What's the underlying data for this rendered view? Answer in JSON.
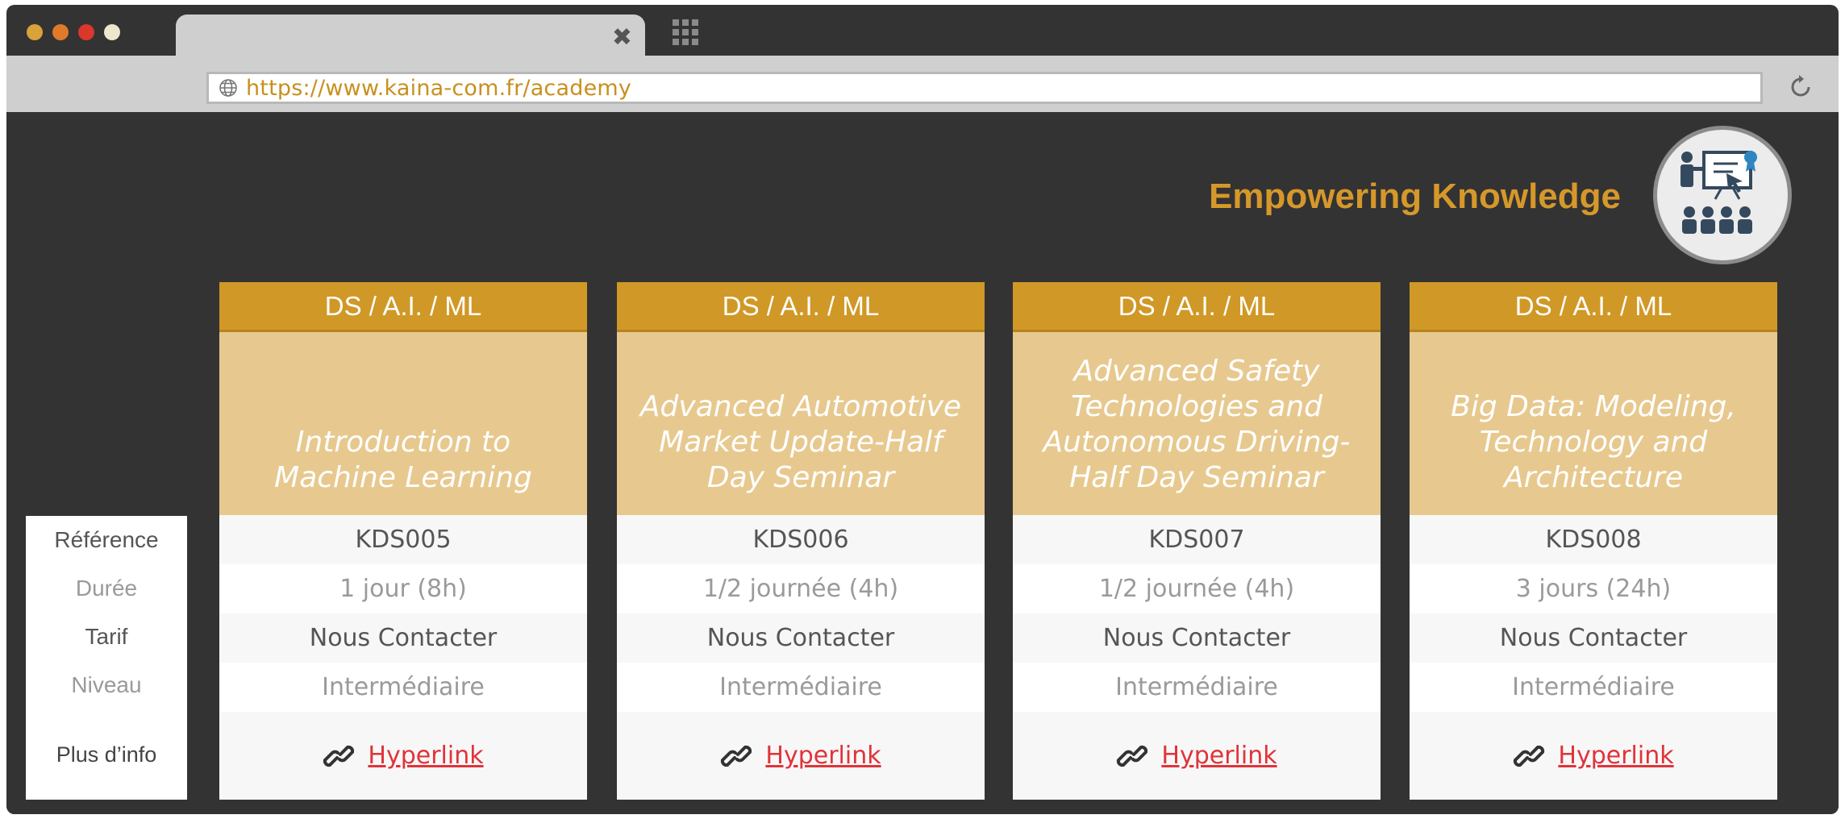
{
  "browser": {
    "dot_colors": [
      "#d9a23a",
      "#e07a2a",
      "#d9382a",
      "#efe6cc"
    ],
    "url": "https://www.kaina-com.fr/academy",
    "tab_close": "✖"
  },
  "header": {
    "tagline": "Empowering Knowledge",
    "accent": "#d6982a"
  },
  "labels": {
    "reference": "Référence",
    "duration": "Durée",
    "price": "Tarif",
    "level": "Niveau",
    "more_info": "Plus d’info"
  },
  "cards": [
    {
      "category": "DS / A.I. / ML",
      "title": "Introduction to Machine Learning",
      "reference": "KDS005",
      "duration": "1 jour (8h)",
      "price": "Nous Contacter",
      "level": "Intermédiaire",
      "link": "Hyperlink"
    },
    {
      "category": "DS / A.I. / ML",
      "title": "Advanced Automotive Market Update-Half Day Seminar",
      "reference": "KDS006",
      "duration": "1/2 journée (4h)",
      "price": "Nous Contacter",
      "level": "Intermédiaire",
      "link": "Hyperlink"
    },
    {
      "category": "DS / A.I. / ML",
      "title": "Advanced Safety Technologies and Autonomous Driving-Half Day Seminar",
      "reference": "KDS007",
      "duration": "1/2 journée (4h)",
      "price": "Nous Contacter",
      "level": "Intermédiaire",
      "link": "Hyperlink"
    },
    {
      "category": "DS / A.I. / ML",
      "title": "Big Data: Modeling, Technology and Architecture",
      "reference": "KDS008",
      "duration": "3 jours (24h)",
      "price": "Nous Contacter",
      "level": "Intermédiaire",
      "link": "Hyperlink"
    }
  ],
  "icons": {
    "globe": "globe-icon",
    "reload": "reload-icon",
    "apps": "apps-grid-icon",
    "logo": "presenter-audience-icon",
    "link": "chain-link-icon"
  }
}
